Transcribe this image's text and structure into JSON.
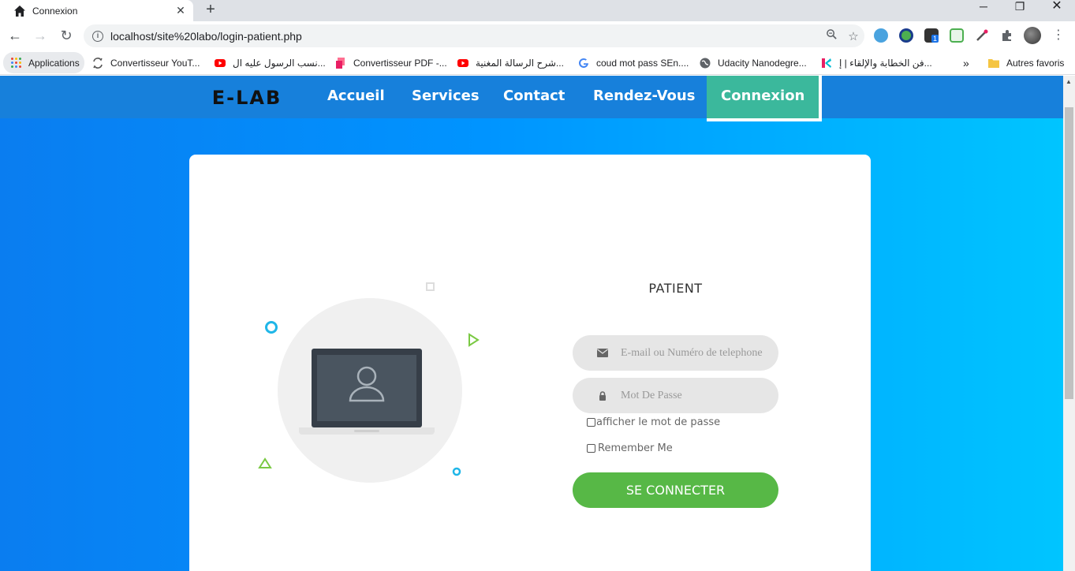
{
  "browser": {
    "tab_title": "Connexion",
    "url": "localhost/site%20labo/login-patient.php",
    "bookmarks": [
      "Applications",
      "Convertisseur YouT...",
      "نسب الرسول عليه ال...",
      "Convertisseur PDF -...",
      "شرح الرسالة المغنية...",
      "coud mot pass SEn....",
      "Udacity Nanodegre...",
      "فن الخطابة والإلقاء | إ...",
      "Autres favoris"
    ],
    "more_bookmarks": "»",
    "extension_badge": "1"
  },
  "nav": {
    "logo": "E-LAB",
    "links": [
      "Accueil",
      "Services",
      "Contact",
      "Rendez-Vous",
      "Connexion"
    ],
    "active": "Connexion"
  },
  "login": {
    "title": "PATIENT",
    "email_placeholder": "E-mail ou Numéro de telephone",
    "password_placeholder": "Mot De Passe",
    "show_password_label": "afficher le mot de passe",
    "remember_label": "Remember Me",
    "submit_label": "SE CONNECTER"
  },
  "colors": {
    "navbar": "#1780db",
    "active_link": "#3bb89c",
    "button": "#57b846",
    "gradient_start": "#0a7df0",
    "gradient_end": "#00c6ff"
  }
}
